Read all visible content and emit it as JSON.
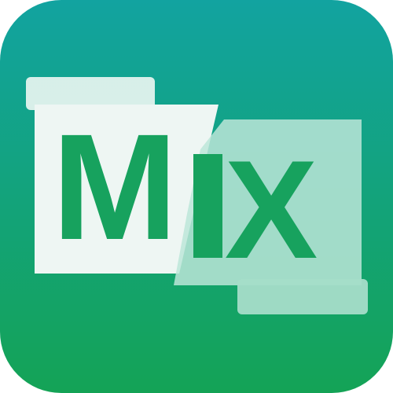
{
  "app_icon": {
    "name": "MX",
    "icon": "mx-logo-icon",
    "letters": [
      "M",
      "X"
    ]
  },
  "colors": {
    "gradient_top": "#12A3A0",
    "gradient_bottom": "#14A356",
    "letter_green": "#17A25E",
    "panel_white": "#EEF6F3",
    "panel_light": "#A5DDC9"
  }
}
